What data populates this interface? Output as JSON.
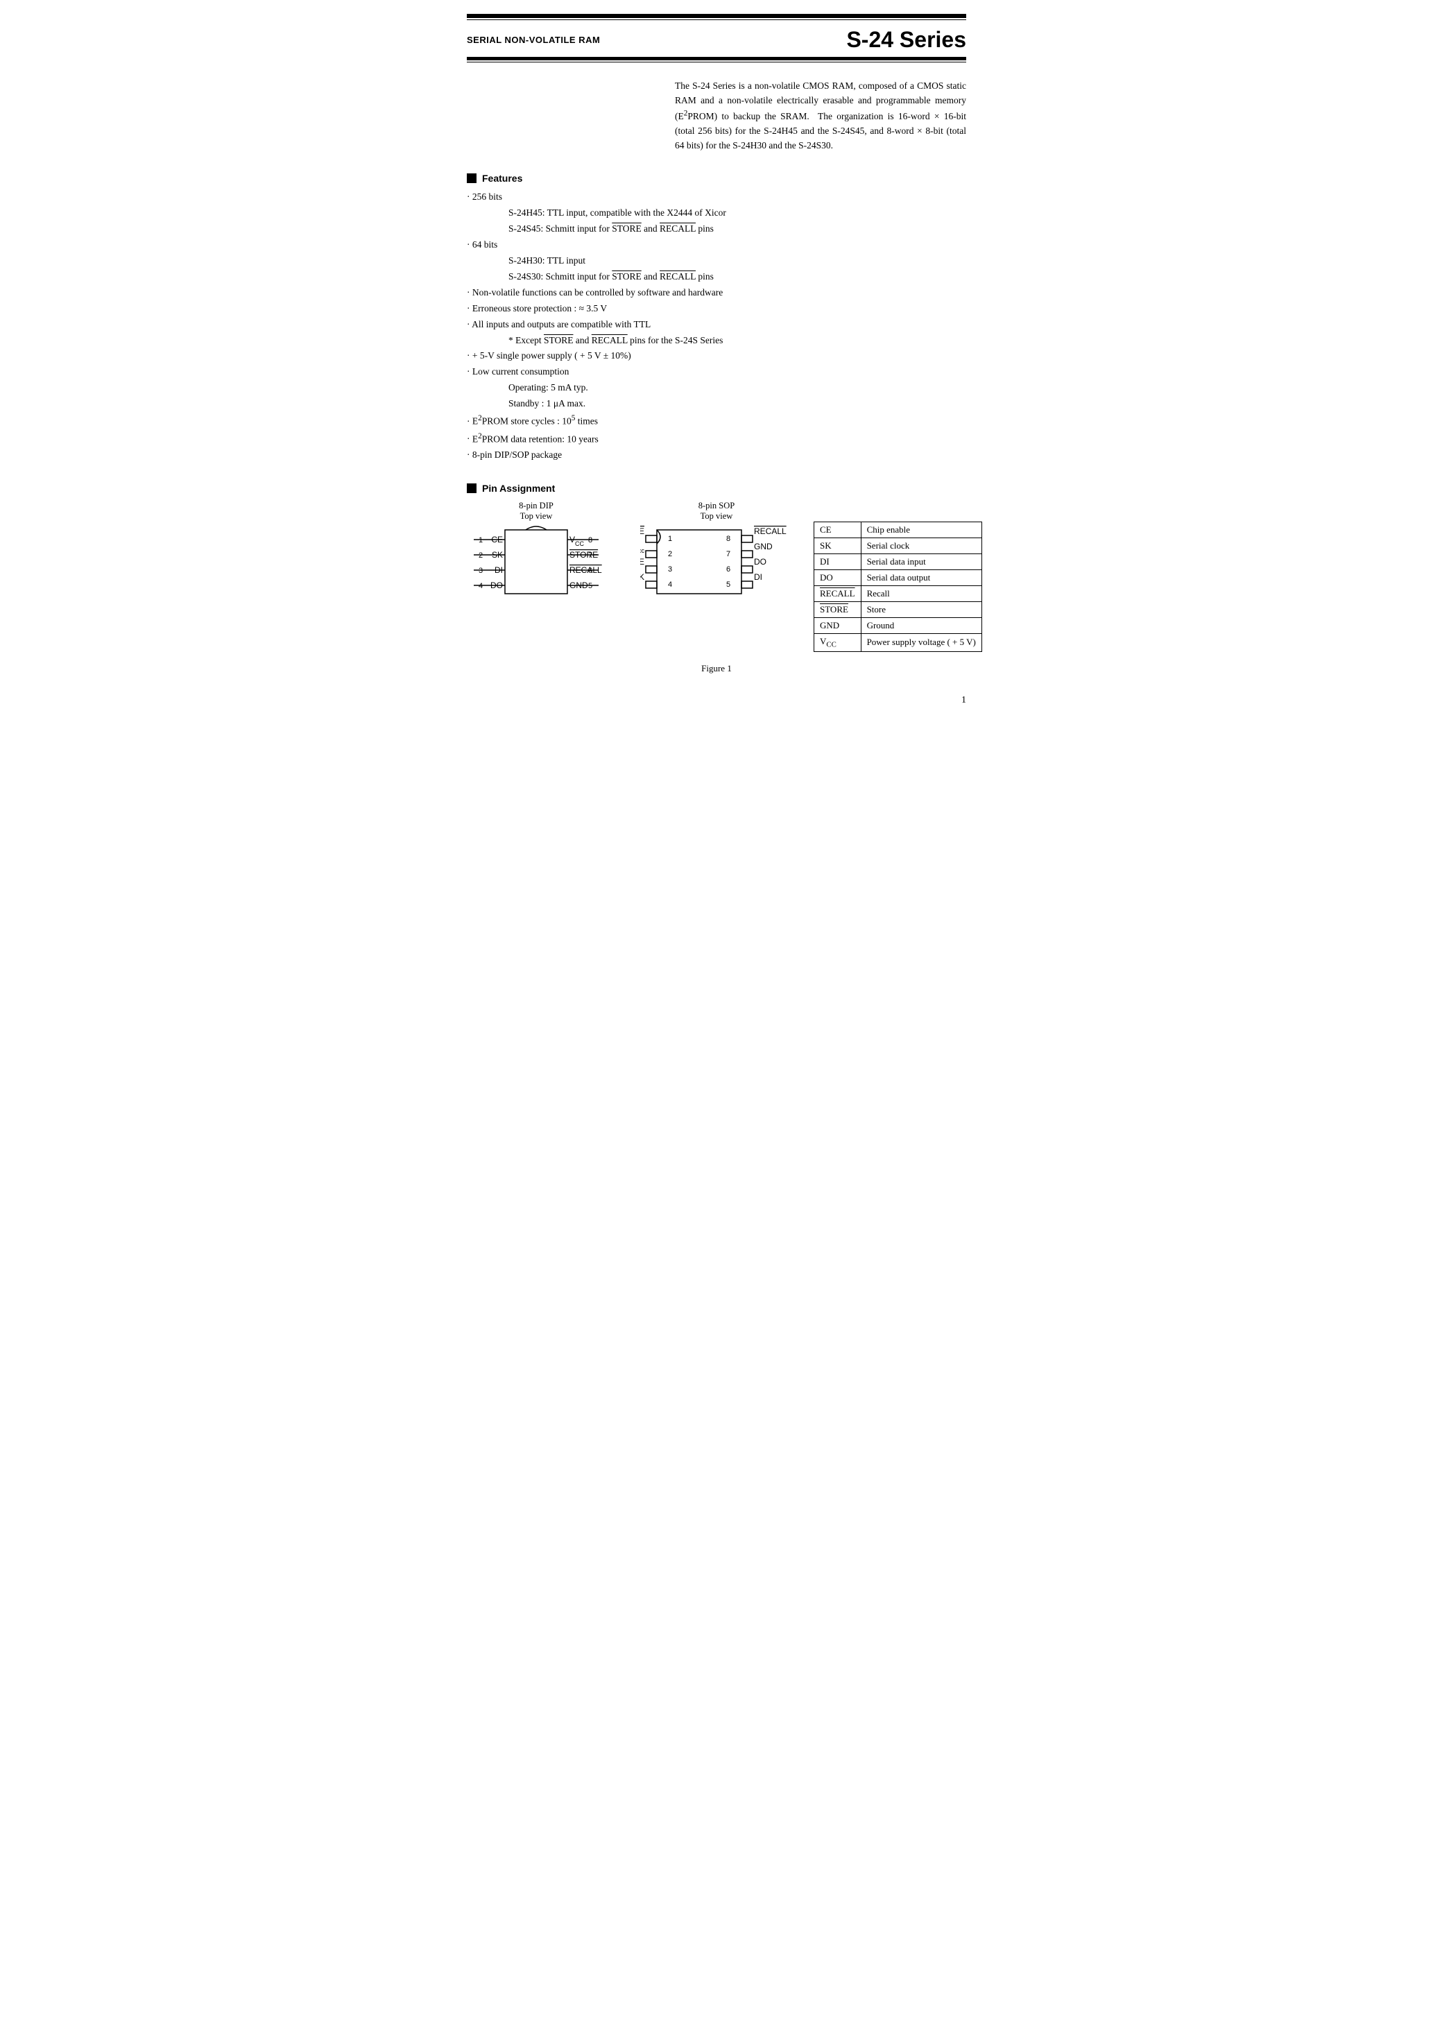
{
  "header": {
    "subtitle": "SERIAL NON-VOLATILE RAM",
    "title": "S-24 Series",
    "rule1_thick": true,
    "rule2_thin": true
  },
  "description": "The S-24 Series is a non-volatile CMOS RAM, composed of a CMOS static RAM and a non-volatile electrically erasable and programmable memory (E²PROM) to backup the SRAM. The organization is 16-word × 16-bit (total 256 bits) for the S-24H45 and the S-24S45, and 8-word × 8-bit (total 64 bits) for the S-24H30 and the S-24S30.",
  "features_title": "Features",
  "features": [
    {
      "text": "256 bits",
      "sub": [
        "S-24H45: TTL input, compatible with the X2444 of Xicor",
        "S-24S45: Schmitt input for STORE and RECALL pins"
      ]
    },
    {
      "text": "64 bits",
      "sub": [
        "S-24H30: TTL input",
        "S-24S30: Schmitt input for STORE and RECALL pins"
      ]
    },
    {
      "text": "Non-volatile functions can be controlled by software and hardware",
      "sub": []
    },
    {
      "text": "Erroneous store protection : ≈ 3.5 V",
      "sub": []
    },
    {
      "text": "All inputs and outputs are compatible with TTL",
      "sub": [
        "* Except STORE and RECALL pins for the S-24S Series"
      ]
    },
    {
      "text": "+ 5-V single power supply ( + 5 V ± 10%)",
      "sub": []
    },
    {
      "text": "Low current consumption",
      "sub": [
        "Operating:  5 mA typ.",
        "Standby  :  1 μA max."
      ]
    },
    {
      "text": "E²PROM store cycles : 10⁵ times",
      "sub": []
    },
    {
      "text": "E²PROM data retention: 10 years",
      "sub": []
    },
    {
      "text": "8-pin DIP/SOP package",
      "sub": []
    }
  ],
  "pin_assignment_title": "Pin Assignment",
  "dip_diagram": {
    "title_line1": "8-pin DIP",
    "title_line2": "Top view",
    "notch": true,
    "left_pins": [
      {
        "label": "CE",
        "num": "1"
      },
      {
        "label": "SK",
        "num": "2"
      },
      {
        "label": "DI",
        "num": "3"
      },
      {
        "label": "DO",
        "num": "4"
      }
    ],
    "right_pins": [
      {
        "label": "Vₜc",
        "num": "8"
      },
      {
        "label": "STORE̅",
        "num": "7"
      },
      {
        "label": "RECALL̅",
        "num": "6"
      },
      {
        "label": "GND",
        "num": "5"
      }
    ]
  },
  "sop_diagram": {
    "title_line1": "8-pin SOP",
    "title_line2": "Top view",
    "left_pins": [
      {
        "label": "STORE",
        "overline": true,
        "num": "1"
      },
      {
        "label": "Vcc",
        "num": "2"
      },
      {
        "label": "CE",
        "num": "3"
      },
      {
        "label": "SK",
        "num": "4"
      }
    ],
    "right_pins": [
      {
        "label": "RECALL",
        "overline": true,
        "num": "8"
      },
      {
        "label": "GND",
        "num": "7"
      },
      {
        "label": "DO",
        "num": "6"
      },
      {
        "label": "DI",
        "num": "5"
      }
    ]
  },
  "pin_table": {
    "rows": [
      {
        "pin": "CE",
        "description": "Chip enable"
      },
      {
        "pin": "SK",
        "description": "Serial clock"
      },
      {
        "pin": "DI",
        "description": "Serial data input"
      },
      {
        "pin": "DO",
        "description": "Serial data output"
      },
      {
        "pin": "RECALL",
        "description": "Recall"
      },
      {
        "pin": "STORE",
        "description": "Store"
      },
      {
        "pin": "GND",
        "description": "Ground"
      },
      {
        "pin": "Vcc",
        "description": "Power supply voltage ( + 5 V)"
      }
    ]
  },
  "figure_caption": "Figure 1",
  "page_number": "1"
}
